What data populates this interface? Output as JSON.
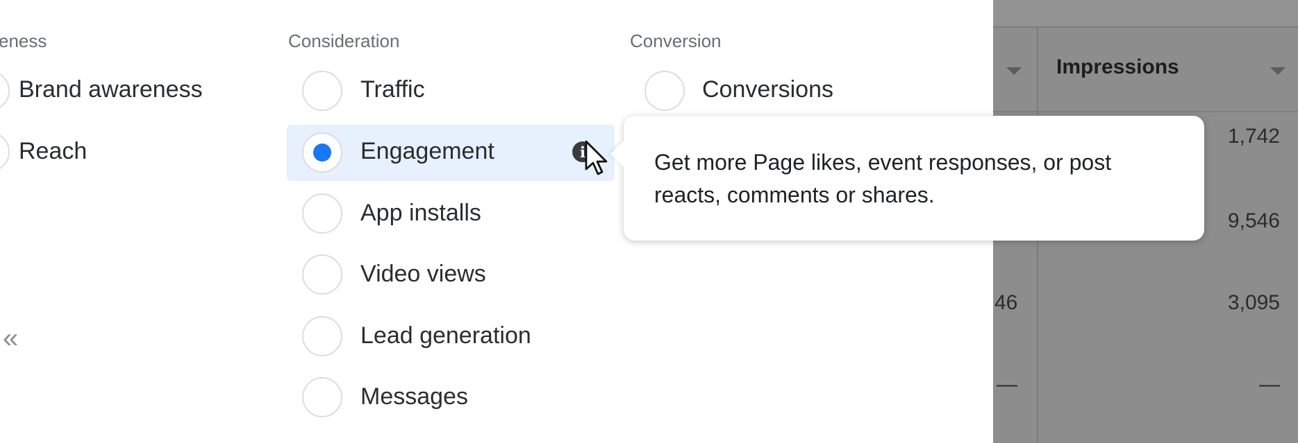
{
  "columns": {
    "awareness": {
      "title": "eness",
      "options": [
        {
          "label": "Brand awareness",
          "checked": false
        },
        {
          "label": "Reach",
          "checked": false
        }
      ]
    },
    "consideration": {
      "title": "Consideration",
      "options": [
        {
          "label": "Traffic",
          "checked": false
        },
        {
          "label": "Engagement",
          "checked": true
        },
        {
          "label": "App installs",
          "checked": false
        },
        {
          "label": "Video views",
          "checked": false
        },
        {
          "label": "Lead generation",
          "checked": false
        },
        {
          "label": "Messages",
          "checked": false
        }
      ]
    },
    "conversion": {
      "title": "Conversion",
      "options": [
        {
          "label": "Conversions",
          "checked": false
        }
      ]
    }
  },
  "tooltip": {
    "text": "Get more Page likes, event responses, or post reacts, comments or shares."
  },
  "collapse_icon": "chevron-double-left",
  "table": {
    "header": "Impressions",
    "rows": [
      {
        "left": "",
        "value": "1,742"
      },
      {
        "left": "",
        "value": "9,546"
      },
      {
        "left": "46",
        "value": "3,095"
      },
      {
        "left": "—",
        "value": "—"
      }
    ]
  },
  "colors": {
    "accent": "#1877f2",
    "selected_bg": "#e7f0fd",
    "overlay_gray": "#8d8d8d"
  }
}
